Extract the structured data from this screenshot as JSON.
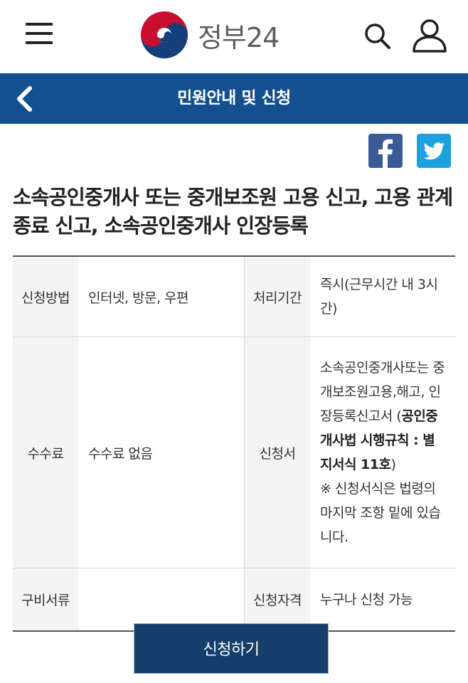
{
  "header": {
    "logo_text": "정부24"
  },
  "navbar": {
    "title": "민원안내 및 신청"
  },
  "share": {
    "facebook": "f"
  },
  "page": {
    "title": "소속공인중개사 또는 중개보조원 고용 신고, 고용 관계 종료 신고, 소속공인중개사 인장등록"
  },
  "info_table": {
    "method_label": "신청방법",
    "method_value": "인터넷, 방문, 우편",
    "period_label": "처리기간",
    "period_value": "즉시(근무시간 내 3시간)",
    "fee_label": "수수료",
    "fee_value": "수수료 없음",
    "form_label": "신청서",
    "form_value_plain": "소속공인중개사또는 중개보조원고용,해고, 인장등록신고서 (",
    "form_value_bold": "공인중개사법 시행규칙 : 별지서식 11호",
    "form_value_close": ")",
    "form_note": "※ 신청서식은 법령의 마지막 조항 밑에 있습니다.",
    "docs_label": "구비서류",
    "docs_value": "",
    "eligibility_label": "신청자격",
    "eligibility_value": "누구나 신청 가능"
  },
  "apply_button": "신청하기",
  "colors": {
    "navbar": "#14508f",
    "button": "#163e6b",
    "facebook": "#3b5b97",
    "twitter": "#1aa1de"
  }
}
